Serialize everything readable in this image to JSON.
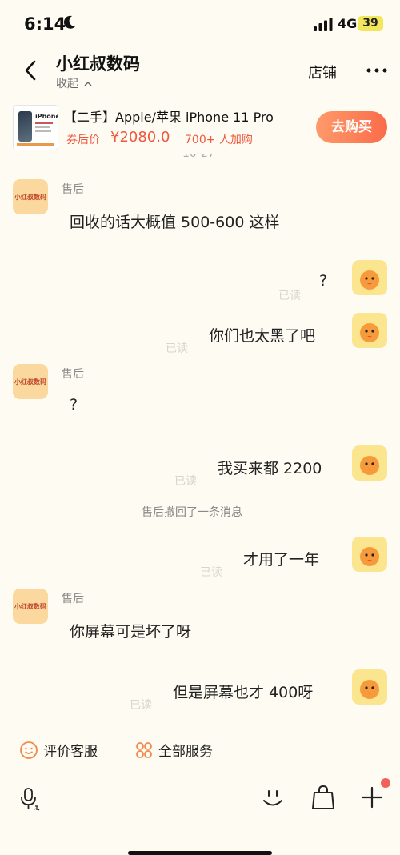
{
  "status_bar": {
    "time": "6:14",
    "network": "4G",
    "battery": "39"
  },
  "header": {
    "title": "小红叔数码",
    "collapse_label": "收起",
    "shop_label": "店铺"
  },
  "product": {
    "image_label": "iPhone",
    "title": "【二手】Apple/苹果 iPhone 11 Pro",
    "price_label": "券后价",
    "price": "¥2080.0",
    "buyers": "700+ 人加购",
    "buy_label": "去购买"
  },
  "chat": {
    "top_cut_text": "10-27",
    "seller_name": "售后",
    "seller_avatar_label": "小红叔数码",
    "read_label": "已读",
    "messages": [
      {
        "from": "seller",
        "text": "回收的话大概值 500-600 这样"
      },
      {
        "from": "user",
        "text": "?"
      },
      {
        "from": "user",
        "text": "你们也太黑了吧"
      },
      {
        "from": "seller",
        "text": "?"
      },
      {
        "from": "user",
        "text": "我买来都 2200"
      },
      {
        "from": "system",
        "text": "售后撤回了一条消息"
      },
      {
        "from": "user",
        "text": "才用了一年"
      },
      {
        "from": "seller",
        "text": "你屏幕可是坏了呀"
      },
      {
        "from": "user",
        "text": "但是屏幕也才 400呀"
      }
    ]
  },
  "bottom_bar": {
    "rate_label": "评价客服",
    "services_label": "全部服务"
  },
  "colors": {
    "accent": "#f0573c",
    "background": "#fdfbf2",
    "avatar": "#fbd89e"
  }
}
